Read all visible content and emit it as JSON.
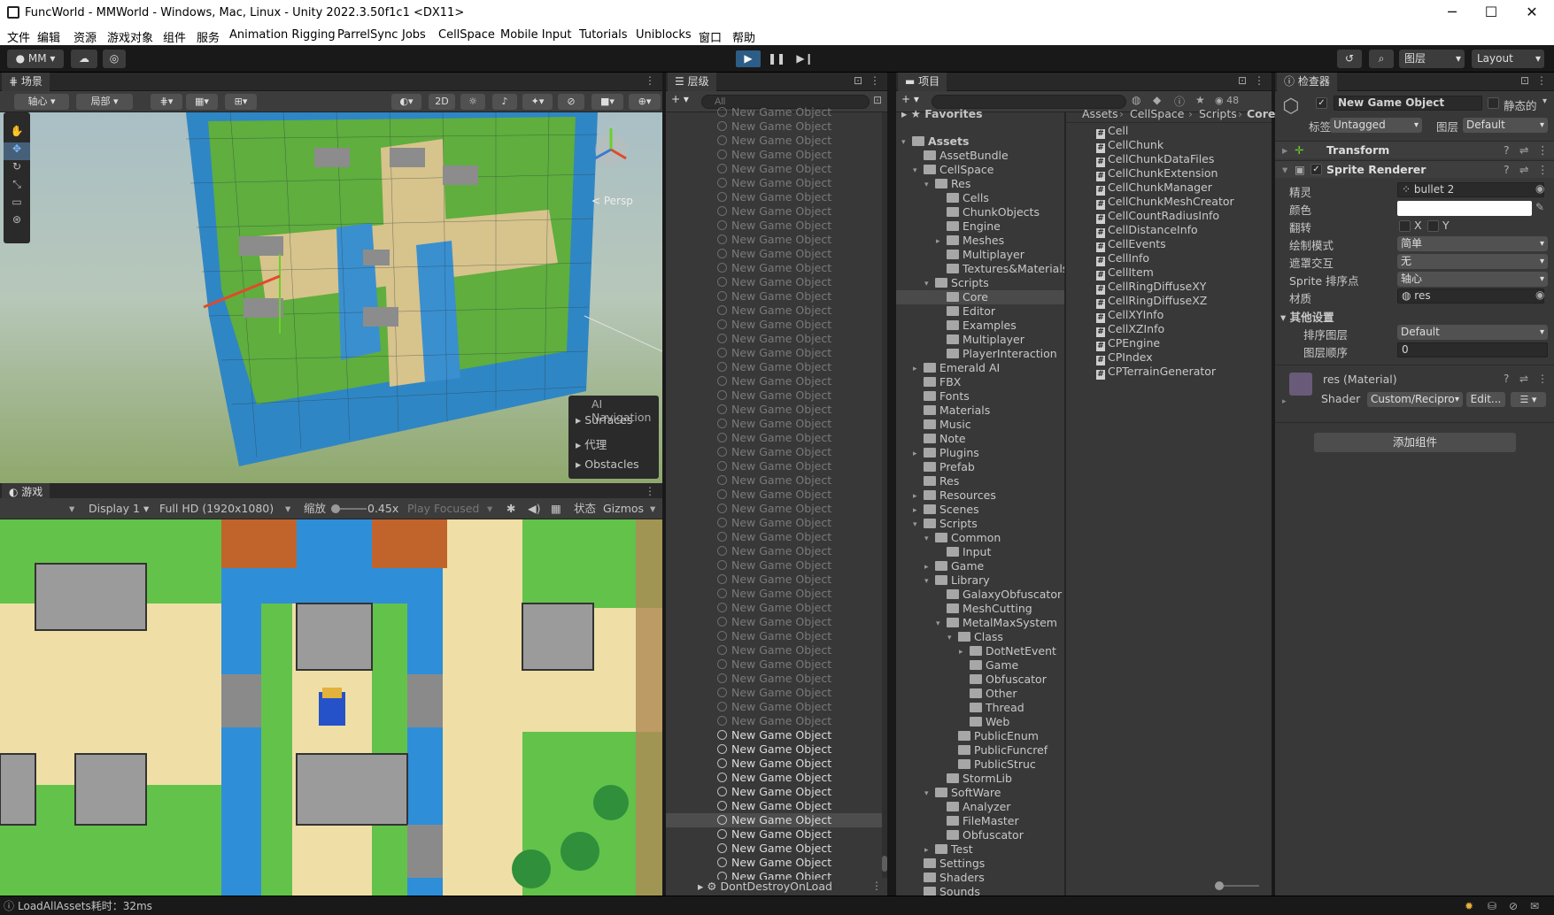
{
  "window": {
    "title": "FuncWorld - MMWorld - Windows, Mac, Linux - Unity 2022.3.50f1c1 <DX11>",
    "minimize": "─",
    "maximize": "☐",
    "close": "✕"
  },
  "menu": [
    "文件",
    "编辑",
    "资源",
    "游戏对象",
    "组件",
    "服务",
    "Animation Rigging",
    "ParrelSync",
    "Jobs",
    "CellSpace",
    "Mobile Input",
    "Tutorials",
    "Uniblocks",
    "窗口",
    "帮助"
  ],
  "toolbar": {
    "account": "MM",
    "layers": "图层",
    "layout": "Layout"
  },
  "scene": {
    "tab": "场景",
    "pivot": "轴心",
    "local": "局部",
    "mode2d": "2D",
    "persp": "< Persp",
    "ai_nav": {
      "title": "AI Navigation",
      "items": [
        "Surfaces",
        "代理",
        "Obstacles"
      ]
    }
  },
  "game": {
    "tab": "游戏",
    "display": "Display 1",
    "resolution": "Full HD (1920x1080)",
    "scale_label": "缩放",
    "scale_value": "0.45x",
    "play_focused": "Play Focused",
    "stats": "状态",
    "gizmos": "Gizmos"
  },
  "hierarchy": {
    "tab": "层级",
    "search_placeholder": "All",
    "dim_item": "New Game Object",
    "dim_count": 44,
    "item": "New Game Object",
    "bright_count": 11,
    "selected_index": 6,
    "ddol": "DontDestroyOnLoad"
  },
  "project": {
    "tab": "项目",
    "count": "48",
    "favorites": "Favorites",
    "breadcrumb": [
      "Assets",
      "CellSpace",
      "Scripts",
      "Core"
    ],
    "tree": [
      {
        "l": "Assets",
        "d": 0,
        "e": "open",
        "b": true
      },
      {
        "l": "AssetBundle",
        "d": 1
      },
      {
        "l": "CellSpace",
        "d": 1,
        "e": "open"
      },
      {
        "l": "Res",
        "d": 2,
        "e": "open"
      },
      {
        "l": "Cells",
        "d": 3
      },
      {
        "l": "ChunkObjects",
        "d": 3
      },
      {
        "l": "Engine",
        "d": 3
      },
      {
        "l": "Meshes",
        "d": 3,
        "e": "closed"
      },
      {
        "l": "Multiplayer",
        "d": 3
      },
      {
        "l": "Textures&Materials",
        "d": 3
      },
      {
        "l": "Scripts",
        "d": 2,
        "e": "open"
      },
      {
        "l": "Core",
        "d": 3,
        "sel": true
      },
      {
        "l": "Editor",
        "d": 3
      },
      {
        "l": "Examples",
        "d": 3
      },
      {
        "l": "Multiplayer",
        "d": 3
      },
      {
        "l": "PlayerInteraction",
        "d": 3
      },
      {
        "l": "Emerald AI",
        "d": 1,
        "e": "closed"
      },
      {
        "l": "FBX",
        "d": 1
      },
      {
        "l": "Fonts",
        "d": 1
      },
      {
        "l": "Materials",
        "d": 1
      },
      {
        "l": "Music",
        "d": 1
      },
      {
        "l": "Note",
        "d": 1
      },
      {
        "l": "Plugins",
        "d": 1,
        "e": "closed"
      },
      {
        "l": "Prefab",
        "d": 1
      },
      {
        "l": "Res",
        "d": 1
      },
      {
        "l": "Resources",
        "d": 1,
        "e": "closed"
      },
      {
        "l": "Scenes",
        "d": 1,
        "e": "closed"
      },
      {
        "l": "Scripts",
        "d": 1,
        "e": "open"
      },
      {
        "l": "Common",
        "d": 2,
        "e": "open"
      },
      {
        "l": "Input",
        "d": 3
      },
      {
        "l": "Game",
        "d": 2,
        "e": "closed"
      },
      {
        "l": "Library",
        "d": 2,
        "e": "open"
      },
      {
        "l": "GalaxyObfuscator",
        "d": 3
      },
      {
        "l": "MeshCutting",
        "d": 3
      },
      {
        "l": "MetalMaxSystem",
        "d": 3,
        "e": "open"
      },
      {
        "l": "Class",
        "d": 4,
        "e": "open"
      },
      {
        "l": "DotNetEvent",
        "d": 5,
        "e": "closed"
      },
      {
        "l": "Game",
        "d": 5
      },
      {
        "l": "Obfuscator",
        "d": 5
      },
      {
        "l": "Other",
        "d": 5
      },
      {
        "l": "Thread",
        "d": 5
      },
      {
        "l": "Web",
        "d": 5
      },
      {
        "l": "PublicEnum",
        "d": 4
      },
      {
        "l": "PublicFuncref",
        "d": 4
      },
      {
        "l": "PublicStruc",
        "d": 4
      },
      {
        "l": "StormLib",
        "d": 3
      },
      {
        "l": "SoftWare",
        "d": 2,
        "e": "open"
      },
      {
        "l": "Analyzer",
        "d": 3
      },
      {
        "l": "FileMaster",
        "d": 3
      },
      {
        "l": "Obfuscator",
        "d": 3
      },
      {
        "l": "Test",
        "d": 2,
        "e": "closed"
      },
      {
        "l": "Settings",
        "d": 1
      },
      {
        "l": "Shaders",
        "d": 1
      },
      {
        "l": "Sounds",
        "d": 1
      }
    ],
    "scripts": [
      "Cell",
      "CellChunk",
      "CellChunkDataFiles",
      "CellChunkExtension",
      "CellChunkManager",
      "CellChunkMeshCreator",
      "CellCountRadiusInfo",
      "CellDistanceInfo",
      "CellEvents",
      "CellInfo",
      "CellItem",
      "CellRingDiffuseXY",
      "CellRingDiffuseXZ",
      "CellXYInfo",
      "CellXZInfo",
      "CPEngine",
      "CPIndex",
      "CPTerrainGenerator"
    ]
  },
  "inspector": {
    "tab": "检查器",
    "name": "New Game Object",
    "static": "静态的",
    "tag_label": "标签",
    "tag": "Untagged",
    "layer_label": "图层",
    "layer": "Default",
    "transform": "Transform",
    "sprite_renderer": "Sprite Renderer",
    "props": [
      {
        "k": "精灵",
        "v": "bullet 2"
      },
      {
        "k": "颜色",
        "v": ""
      },
      {
        "k": "翻转",
        "v": "X    Y"
      },
      {
        "k": "绘制模式",
        "v": "简单"
      },
      {
        "k": "遮罩交互",
        "v": "无"
      },
      {
        "k": "Sprite 排序点",
        "v": "轴心"
      },
      {
        "k": "材质",
        "v": "res"
      }
    ],
    "other": "其他设置",
    "sorting_layer_label": "排序图层",
    "sorting_layer": "Default",
    "order_label": "图层顺序",
    "order": "0",
    "material": "res (Material)",
    "shader_label": "Shader",
    "shader": "Custom/Recipro",
    "edit": "Edit...",
    "add_component": "添加组件"
  },
  "status": "LoadAllAssets耗时：32ms",
  "colors": {
    "accent": "#2c5d87",
    "panel": "#383838",
    "dark": "#282828"
  }
}
